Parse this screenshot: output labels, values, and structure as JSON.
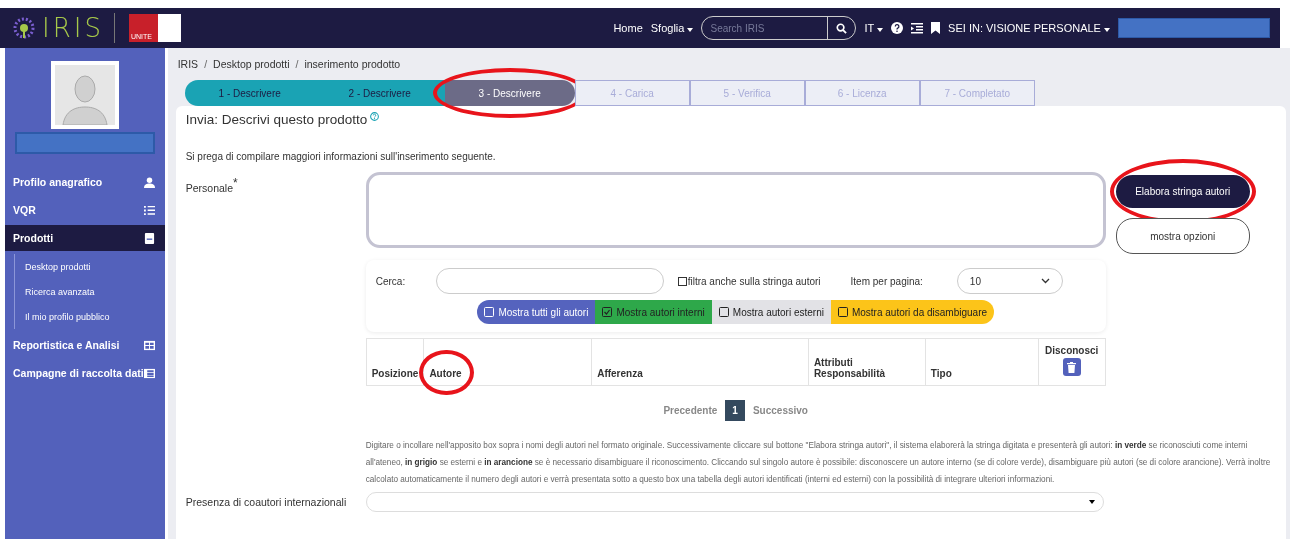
{
  "navbar": {
    "logo": "IRIS",
    "partner_logo": "UNITE",
    "links": [
      {
        "label": "Home",
        "dropdown": false
      },
      {
        "label": "Sfoglia",
        "dropdown": true
      }
    ],
    "search": {
      "placeholder": "Search IRIS"
    },
    "language": "IT",
    "view_label": "SEI IN: VISIONE PERSONALE"
  },
  "sidebar": {
    "items": [
      {
        "label": "Profilo anagrafico",
        "selected": false
      },
      {
        "label": "VQR",
        "selected": false
      },
      {
        "label": "Prodotti",
        "selected": true,
        "children": [
          {
            "label": "Desktop prodotti"
          },
          {
            "label": "Ricerca avanzata"
          },
          {
            "label": "Il mio profilo pubblico"
          }
        ]
      },
      {
        "label": "Reportistica e Analisi",
        "selected": false
      },
      {
        "label": "Campagne di raccolta dati",
        "selected": false
      }
    ]
  },
  "breadcrumb": {
    "separator": "/",
    "items": [
      "IRIS",
      "Desktop prodotti",
      "inserimento prodotto"
    ]
  },
  "steps": [
    {
      "label": "1 - Descrivere",
      "done": true,
      "selected": false,
      "circled": false
    },
    {
      "label": "2 - Descrivere",
      "done": true,
      "selected": false,
      "circled": false
    },
    {
      "label": "3 - Descrivere",
      "done": false,
      "selected": true,
      "circled": true
    },
    {
      "label": "4 - Carica",
      "done": false,
      "selected": false,
      "circled": false
    },
    {
      "label": "5 - Verifica",
      "done": false,
      "selected": false,
      "circled": false
    },
    {
      "label": "6 - Licenza",
      "done": false,
      "selected": false,
      "circled": false
    },
    {
      "label": "7 - Completato",
      "done": false,
      "selected": false,
      "circled": false
    }
  ],
  "form": {
    "title": "Invia: Descrivi questo prodotto",
    "intro": "Si prega di compilare maggiori informazioni sull'inserimento seguente.",
    "personale_label": "Personale",
    "required_mark": "*",
    "buttons": [
      {
        "label": "Elabora stringa autori",
        "kind": "primary",
        "circled": true
      },
      {
        "label": "mostra opzioni",
        "kind": "outline",
        "circled": false
      }
    ],
    "search_label": "Cerca:",
    "filter_checkbox": {
      "label": "filtra anche sulla stringa autori",
      "checked": false
    },
    "per_page_label": "Item per pagina:",
    "per_page_value": "10",
    "chips": [
      {
        "label": "Mostra tutti gli autori",
        "checked": false,
        "color": "#5563be"
      },
      {
        "label": "Mostra autori interni",
        "checked": true,
        "color": "#2ea84a"
      },
      {
        "label": "Mostra autori esterni",
        "checked": false,
        "color": "#e2e2e6"
      },
      {
        "label": "Mostra autori da disambiguare",
        "checked": false,
        "color": "#fcc419"
      }
    ],
    "columns": [
      {
        "label": "Posizione",
        "circled": false
      },
      {
        "label": "Autore",
        "circled": true
      },
      {
        "label": "Afferenza",
        "circled": false
      },
      {
        "label": "Attributi Responsabilità",
        "circled": false
      },
      {
        "label": "Tipo",
        "circled": false
      },
      {
        "label": "Disconosci",
        "circled": false
      }
    ],
    "pagination": [
      {
        "label": "Precedente",
        "selected": false
      },
      {
        "label": "1",
        "selected": true
      },
      {
        "label": "Successivo",
        "selected": false
      }
    ],
    "help": "Digitare o incollare nell'apposito box sopra i nomi degli autori nel formato originale. Successivamente cliccare sul bottone \"Elabora stringa autori\", il sistema elaborerà la stringa digitata e presenterà gli autori: **in verde** se riconosciuti come interni all'ateneo, **in grigio** se esterni e **in arancione** se è necessario disambiguare il riconoscimento. Cliccando sul singolo autore è possibile: disconoscere un autore interno (se di colore verde), disambiguare più autori (se di colore arancione). Verrà inoltre calcolato automaticamente il numero degli autori e verrà presentata sotto a questo box una tabella degli autori identificati (interni ed esterni) con la possibilità di integrare ulteriori informazioni.",
    "coauthors_label": "Presenza di coautori internazionali"
  }
}
